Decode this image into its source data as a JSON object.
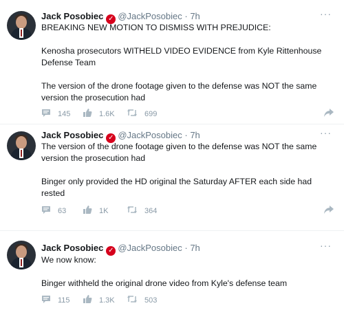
{
  "tweets": [
    {
      "author_name": "Jack Posobiec",
      "handle": "@JackPosobiec",
      "dot": "·",
      "time": "7h",
      "lines": [
        "BREAKING NEW MOTION TO DISMISS WITH PREJUDICE:",
        "Kenosha prosecutors WITHELD VIDEO EVIDENCE from Kyle Rittenhouse Defense Team",
        "The version of the drone footage given to the defense was NOT the same version the prosecution had"
      ],
      "replies": "145",
      "likes": "1.6K",
      "retweets": "699"
    },
    {
      "author_name": "Jack Posobiec",
      "handle": "@JackPosobiec",
      "dot": "·",
      "time": "7h",
      "lines": [
        "The version of the drone footage given to the defense was NOT the same version the prosecution had",
        "Binger only provided the HD original the Saturday AFTER each side had rested"
      ],
      "replies": "63",
      "likes": "1K",
      "retweets": "364"
    },
    {
      "author_name": "Jack Posobiec",
      "handle": "@JackPosobiec",
      "dot": "·",
      "time": "7h",
      "lines": [
        "We now know:",
        "Binger withheld the original drone video from Kyle's defense team"
      ],
      "replies": "115",
      "likes": "1.3K",
      "retweets": "503"
    }
  ],
  "more_label": "···",
  "verified_mark": "✓",
  "icons": {
    "reply": "comment-icon",
    "like": "like-icon",
    "retweet": "retweet-icon",
    "share": "share-icon",
    "more": "more-options-icon",
    "verified": "verified-badge-icon"
  },
  "colors": {
    "verified_badge": "#d6001c",
    "muted_text": "#657786",
    "icon_gray": "#8899a6"
  }
}
